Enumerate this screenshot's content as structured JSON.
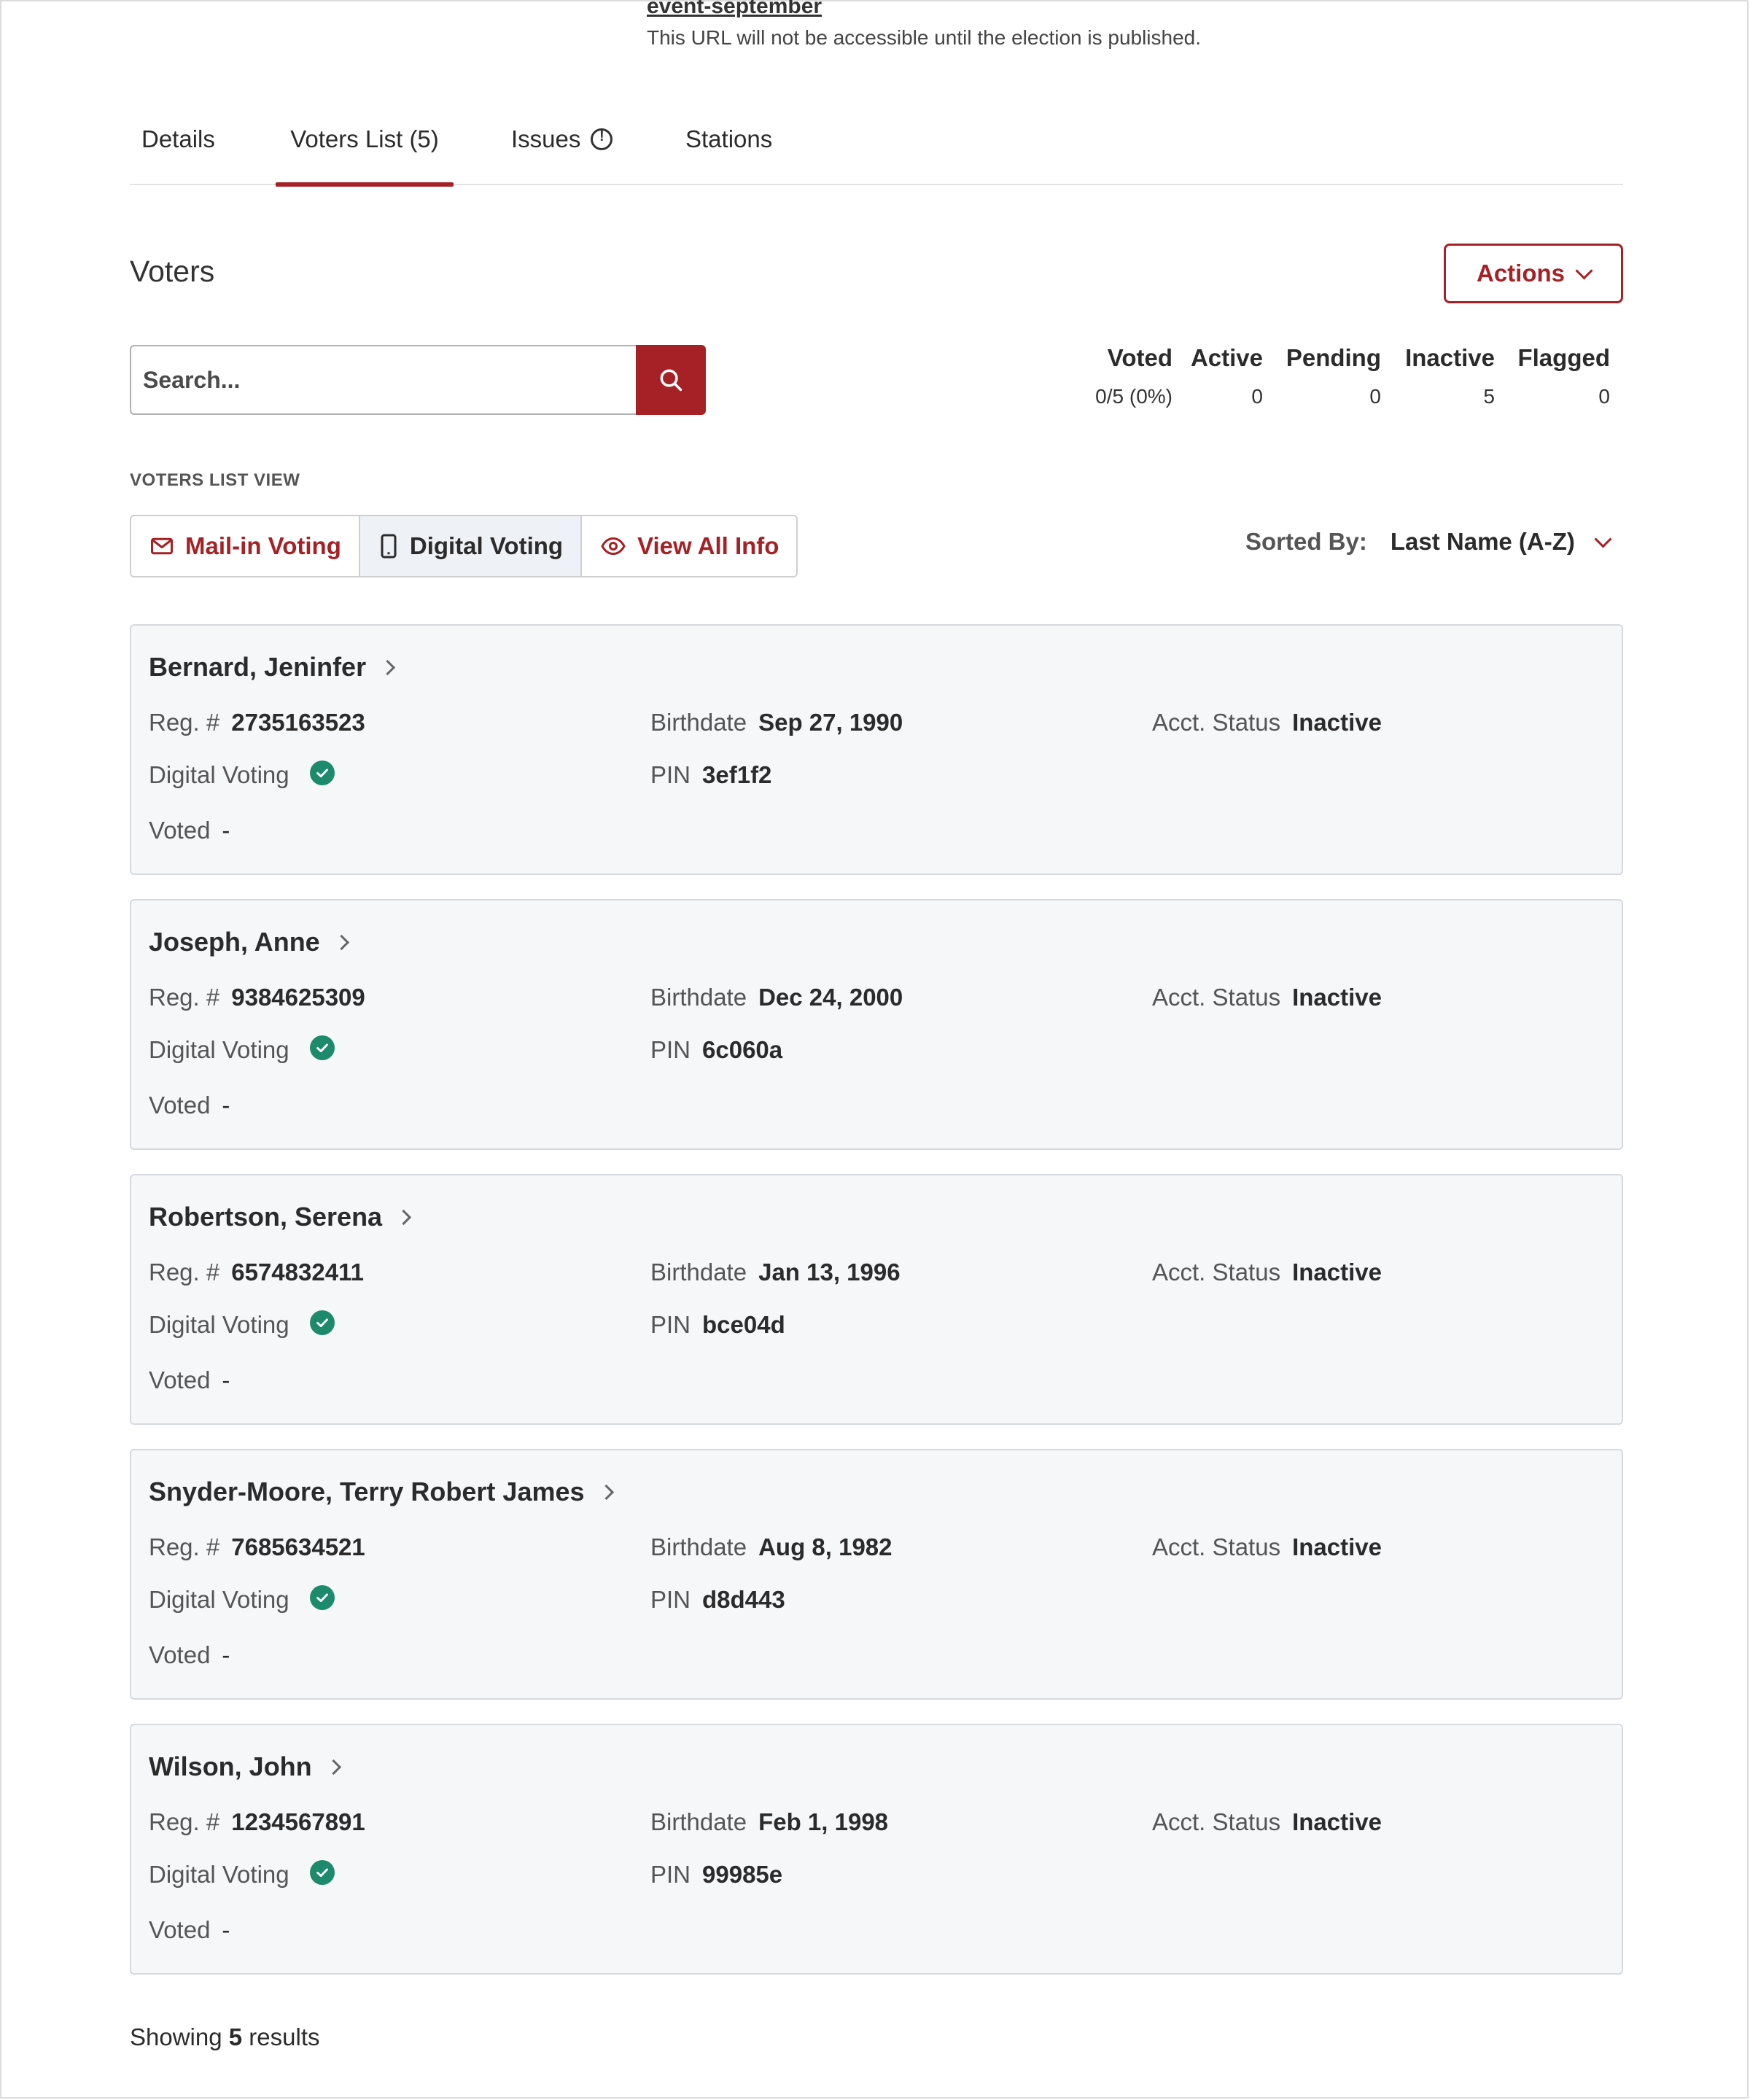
{
  "url": {
    "slug": "event-september",
    "note": "This URL will not be accessible until the election is published."
  },
  "tabs": [
    {
      "label": "Details"
    },
    {
      "label": "Voters List (5)"
    },
    {
      "label": "Issues"
    },
    {
      "label": "Stations"
    }
  ],
  "section": {
    "title": "Voters",
    "actions_label": "Actions"
  },
  "search": {
    "placeholder": "Search..."
  },
  "stats": [
    {
      "label": "Voted",
      "value": "0/5 (0%)"
    },
    {
      "label": "Active",
      "value": "0"
    },
    {
      "label": "Pending",
      "value": "0"
    },
    {
      "label": "Inactive",
      "value": "5"
    },
    {
      "label": "Flagged",
      "value": "0"
    }
  ],
  "list_view": {
    "label": "VOTERS LIST VIEW",
    "buttons": [
      {
        "label": "Mail-in Voting",
        "icon": "mail-icon"
      },
      {
        "label": "Digital Voting",
        "icon": "phone-icon",
        "selected": true
      },
      {
        "label": "View All Info",
        "icon": "eye-icon"
      }
    ]
  },
  "sort": {
    "label": "Sorted By:",
    "value": "Last Name (A-Z)"
  },
  "field_labels": {
    "reg": "Reg. #",
    "birthdate": "Birthdate",
    "acct_status": "Acct. Status",
    "digital_voting": "Digital Voting",
    "pin": "PIN",
    "voted": "Voted"
  },
  "voters": [
    {
      "name": "Bernard, Jeninfer",
      "reg": "2735163523",
      "birthdate": "Sep 27, 1990",
      "status": "Inactive",
      "pin": "3ef1f2",
      "voted": "-"
    },
    {
      "name": "Joseph, Anne",
      "reg": "9384625309",
      "birthdate": "Dec 24, 2000",
      "status": "Inactive",
      "pin": "6c060a",
      "voted": "-"
    },
    {
      "name": "Robertson, Serena",
      "reg": "6574832411",
      "birthdate": "Jan 13, 1996",
      "status": "Inactive",
      "pin": "bce04d",
      "voted": "-"
    },
    {
      "name": "Snyder-Moore, Terry Robert James",
      "reg": "7685634521",
      "birthdate": "Aug 8, 1982",
      "status": "Inactive",
      "pin": "d8d443",
      "voted": "-"
    },
    {
      "name": "Wilson, John",
      "reg": "1234567891",
      "birthdate": "Feb 1, 1998",
      "status": "Inactive",
      "pin": "99985e",
      "voted": "-"
    }
  ],
  "results": {
    "prefix": "Showing",
    "count": "5",
    "suffix": "results"
  },
  "colors": {
    "accent": "#a52126",
    "check": "#1d8a6b",
    "card_bg": "#f6f7f9"
  }
}
